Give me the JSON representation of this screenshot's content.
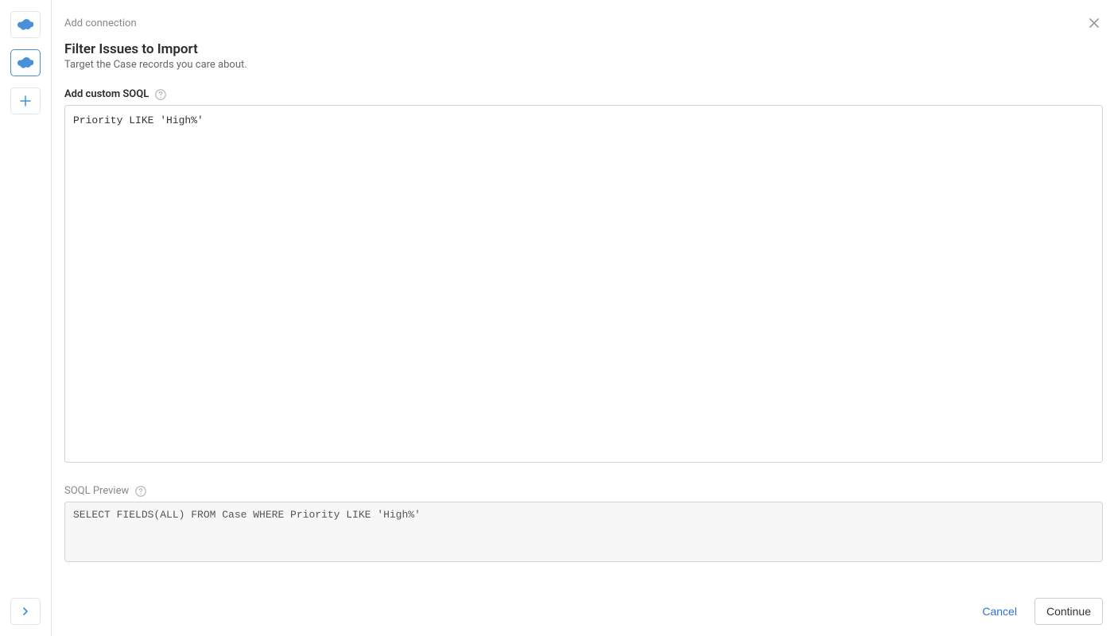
{
  "sidebar": {
    "items": [
      {
        "name": "salesforce-connection-1"
      },
      {
        "name": "salesforce-connection-2"
      },
      {
        "name": "add-connection"
      }
    ]
  },
  "header": {
    "add_connection": "Add connection"
  },
  "page": {
    "title": "Filter Issues to Import",
    "subtitle": "Target the Case records you care about."
  },
  "soql": {
    "label": "Add custom SOQL",
    "value": "Priority LIKE 'High%'"
  },
  "preview": {
    "label": "SOQL Preview",
    "value": "SELECT FIELDS(ALL) FROM Case WHERE Priority LIKE 'High%'"
  },
  "footer": {
    "cancel": "Cancel",
    "continue": "Continue"
  }
}
